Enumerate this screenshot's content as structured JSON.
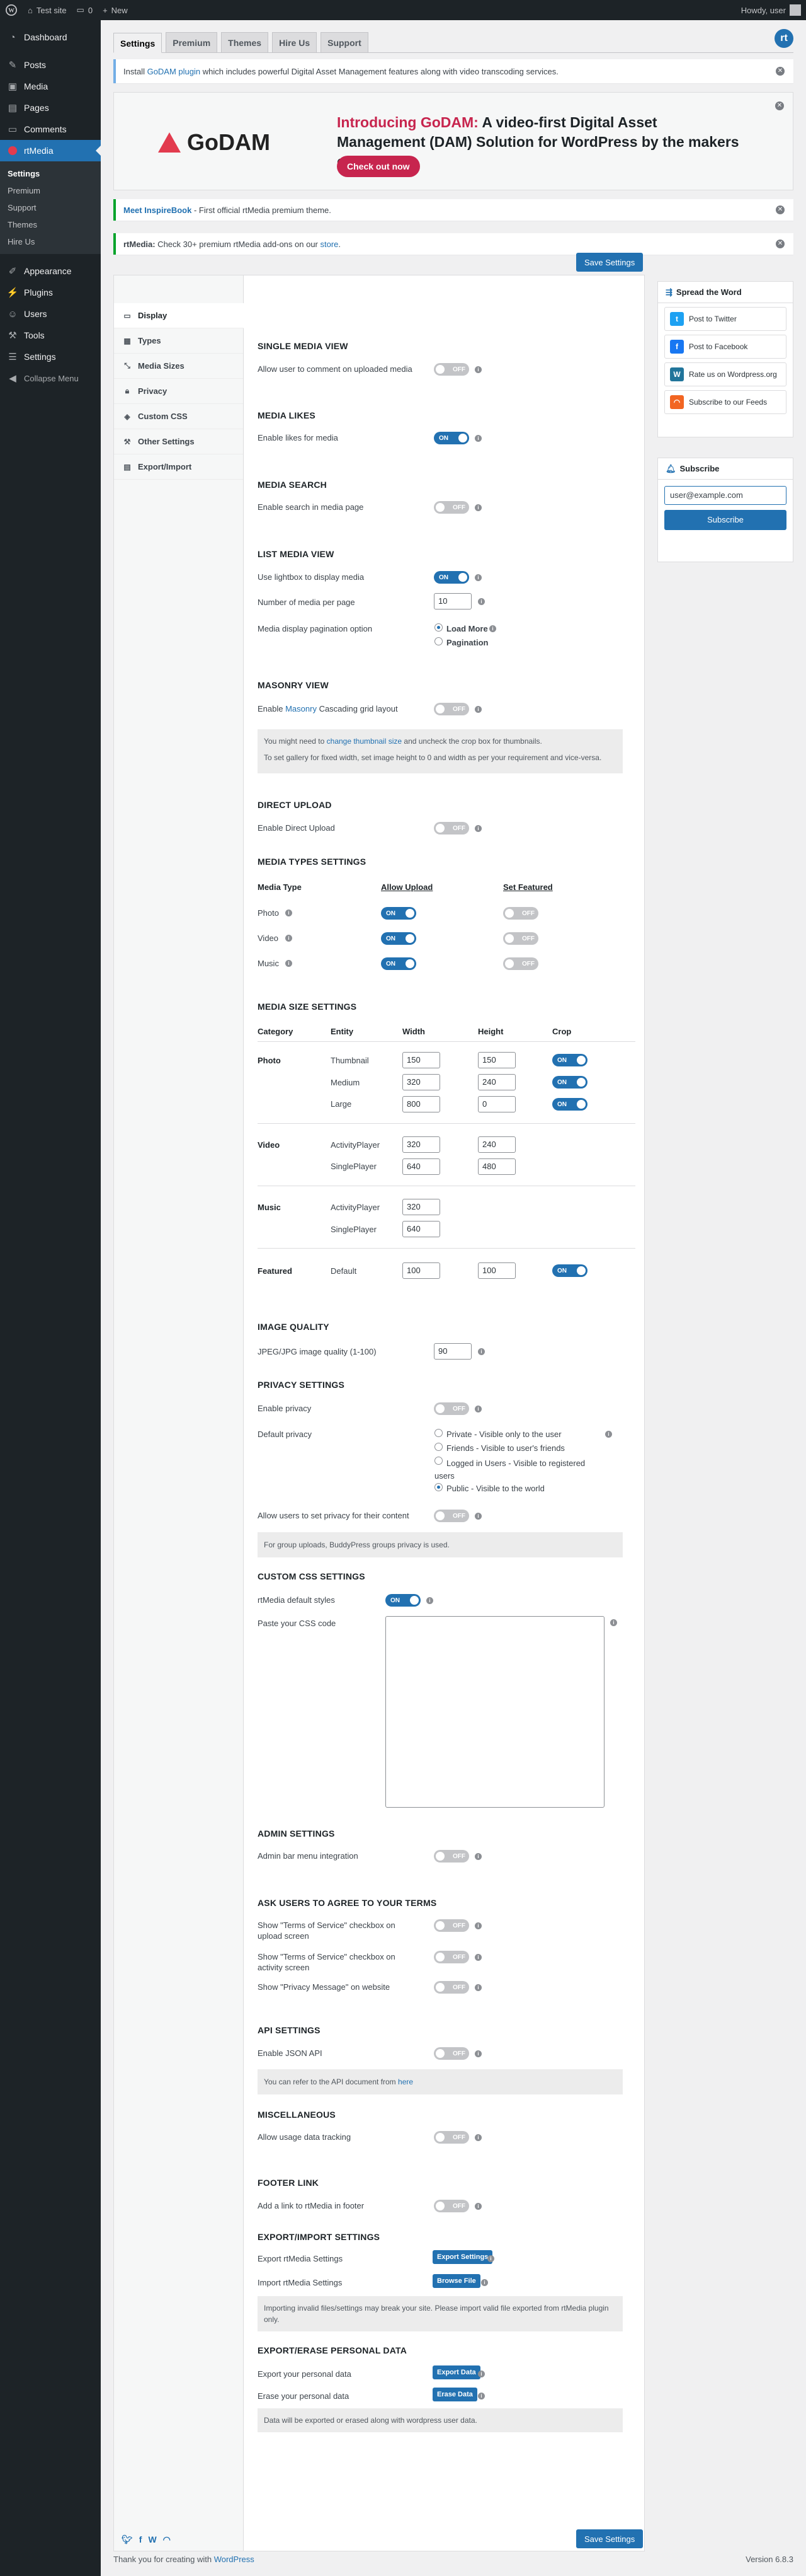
{
  "admin_bar": {
    "site_name": "Test site",
    "comments_count": "0",
    "new_label": "New",
    "howdy": "Howdy, user"
  },
  "sidebar": {
    "items": [
      {
        "label": "Dashboard",
        "icon": "dashboard-icon"
      },
      {
        "label": "Posts",
        "icon": "pin-icon"
      },
      {
        "label": "Media",
        "icon": "media-icon"
      },
      {
        "label": "Pages",
        "icon": "page-icon"
      },
      {
        "label": "Comments",
        "icon": "comment-icon"
      },
      {
        "label": "rtMedia",
        "icon": "rtmedia-icon"
      }
    ],
    "submenu": [
      "Settings",
      "Premium",
      "Support",
      "Themes",
      "Hire Us"
    ],
    "items2": [
      {
        "label": "Appearance",
        "icon": "brush-icon"
      },
      {
        "label": "Plugins",
        "icon": "plug-icon"
      },
      {
        "label": "Users",
        "icon": "users-icon"
      },
      {
        "label": "Tools",
        "icon": "wrench-icon"
      },
      {
        "label": "Settings",
        "icon": "sliders-icon"
      },
      {
        "label": "Collapse Menu",
        "icon": "collapse-icon"
      }
    ]
  },
  "top_tabs": [
    "Settings",
    "Premium",
    "Themes",
    "Hire Us",
    "Support"
  ],
  "logo_letter": "rt",
  "notices": {
    "godam_prefix": "Install ",
    "godam_link": "GoDAM plugin",
    "godam_suffix": " which includes powerful Digital Asset Management features along with video transcoding services.",
    "inspire_link": "Meet InspireBook",
    "inspire_suffix": " - First official rtMedia premium theme.",
    "addons_bold": "rtMedia:",
    "addons_text": " Check 30+ premium rtMedia add-ons on our ",
    "addons_link": "store",
    "addons_end": "."
  },
  "banner": {
    "logo": "GoDAM",
    "title_intro": "Introducing GoDAM:",
    "title_rest": " A video-first Digital Asset Management (DAM) Solution for WordPress by the makers of rtMedia",
    "button": "Check out now"
  },
  "save_label": "Save Settings",
  "vtabs": [
    {
      "label": "Display",
      "icon": "desktop-icon"
    },
    {
      "label": "Types",
      "icon": "types-icon"
    },
    {
      "label": "Media Sizes",
      "icon": "resize-icon"
    },
    {
      "label": "Privacy",
      "icon": "lock-icon"
    },
    {
      "label": "Custom CSS",
      "icon": "code-icon"
    },
    {
      "label": "Other Settings",
      "icon": "wrench-icon"
    },
    {
      "label": "Export/Import",
      "icon": "file-icon"
    }
  ],
  "display": {
    "single_h": "SINGLE MEDIA VIEW",
    "single_comment": "Allow user to comment on uploaded media",
    "likes_h": "MEDIA LIKES",
    "likes_enable": "Enable likes for media",
    "search_h": "MEDIA SEARCH",
    "search_enable": "Enable search in media page",
    "list_h": "LIST MEDIA VIEW",
    "lightbox": "Use lightbox to display media",
    "per_page": "Number of media per page",
    "per_page_value": "10",
    "pagination": "Media display pagination option",
    "load_more": "Load More",
    "pagination_opt": "Pagination",
    "masonry_h": "MASONRY VIEW",
    "masonry_pre": "Enable ",
    "masonry_link": "Masonry",
    "masonry_post": " Cascading grid layout",
    "masonry_info1_pre": "You might need to ",
    "masonry_info1_link": "change thumbnail size",
    "masonry_info1_post": " and uncheck the crop box for thumbnails.",
    "masonry_info2": "To set gallery for fixed width, set image height to 0 and width as per your requirement and vice-versa.",
    "direct_h": "DIRECT UPLOAD",
    "direct_enable": "Enable Direct Upload"
  },
  "types": {
    "h": "MEDIA TYPES SETTINGS",
    "col1": "Media Type",
    "col2": "Allow Upload",
    "col3": "Set Featured",
    "rows": [
      {
        "label": "Photo"
      },
      {
        "label": "Video"
      },
      {
        "label": "Music"
      }
    ]
  },
  "sizes": {
    "h": "MEDIA SIZE SETTINGS",
    "cols": [
      "Category",
      "Entity",
      "Width",
      "Height",
      "Crop"
    ],
    "photo": "Photo",
    "thumbnail": "Thumbnail",
    "medium": "Medium",
    "large": "Large",
    "thumb_w": "150",
    "thumb_h": "150",
    "medium_w": "320",
    "medium_h": "240",
    "large_w": "800",
    "large_h": "0",
    "video": "Video",
    "activity_player": "ActivityPlayer",
    "single_player": "SinglePlayer",
    "video_ap_w": "320",
    "video_ap_h": "240",
    "video_sp_w": "640",
    "video_sp_h": "480",
    "music": "Music",
    "music_ap_w": "320",
    "music_sp_w": "640",
    "featured": "Featured",
    "default": "Default",
    "feat_w": "100",
    "feat_h": "100"
  },
  "quality": {
    "h": "IMAGE QUALITY",
    "label": "JPEG/JPG image quality (1-100)",
    "value": "90"
  },
  "privacy": {
    "h": "PRIVACY SETTINGS",
    "enable": "Enable privacy",
    "default": "Default privacy",
    "opt_private": "Private - Visible only to the user",
    "opt_friends": "Friends - Visible to user's friends",
    "opt_logged": "Logged in Users - Visible to registered users",
    "opt_public": "Public - Visible to the world",
    "allow": "Allow users to set privacy for their content",
    "info": "For group uploads, BuddyPress groups privacy is used."
  },
  "css": {
    "h": "CUSTOM CSS SETTINGS",
    "default_styles": "rtMedia default styles",
    "paste": "Paste your CSS code"
  },
  "admin": {
    "h": "ADMIN SETTINGS",
    "bar": "Admin bar menu integration"
  },
  "terms": {
    "h": "ASK USERS TO AGREE TO YOUR TERMS",
    "upload": "Show \"Terms of Service\" checkbox on upload screen",
    "activity": "Show \"Terms of Service\" checkbox on activity screen",
    "privacy_msg": "Show \"Privacy Message\" on website"
  },
  "api": {
    "h": "API SETTINGS",
    "enable": "Enable JSON API",
    "info_pre": "You can refer to the API document from ",
    "info_link": "here"
  },
  "misc": {
    "h": "MISCELLANEOUS",
    "tracking": "Allow usage data tracking"
  },
  "footer_link": {
    "h": "FOOTER LINK",
    "add": "Add a link to rtMedia in footer"
  },
  "export": {
    "h": "EXPORT/IMPORT SETTINGS",
    "export_label": "Export rtMedia Settings",
    "export_btn": "Export Settings",
    "import_label": "Import rtMedia Settings",
    "import_btn": "Browse File",
    "info": "Importing invalid files/settings may break your site. Please import valid file exported from rtMedia plugin only."
  },
  "personal": {
    "h": "EXPORT/ERASE PERSONAL DATA",
    "export_label": "Export your personal data",
    "export_btn": "Export Data",
    "erase_label": "Erase your personal data",
    "erase_btn": "Erase Data",
    "info": "Data will be exported or erased along with wordpress user data."
  },
  "toggle_on": "ON",
  "toggle_off": "OFF",
  "widgets": {
    "spread_h": "Spread the Word",
    "twitter": "Post to Twitter",
    "facebook": "Post to Facebook",
    "wordpress": "Rate us on Wordpress.org",
    "feeds": "Subscribe to our Feeds",
    "subscribe_h": "Subscribe",
    "email": "user@example.com",
    "subscribe_btn": "Subscribe"
  },
  "wpfooter": {
    "pre": "Thank you for creating with ",
    "link": "WordPress",
    "version": "Version 6.8.3"
  },
  "colors": {
    "accent": "#2271b1",
    "banner_accent": "#c7254e",
    "sidebar": "#1d2327"
  }
}
